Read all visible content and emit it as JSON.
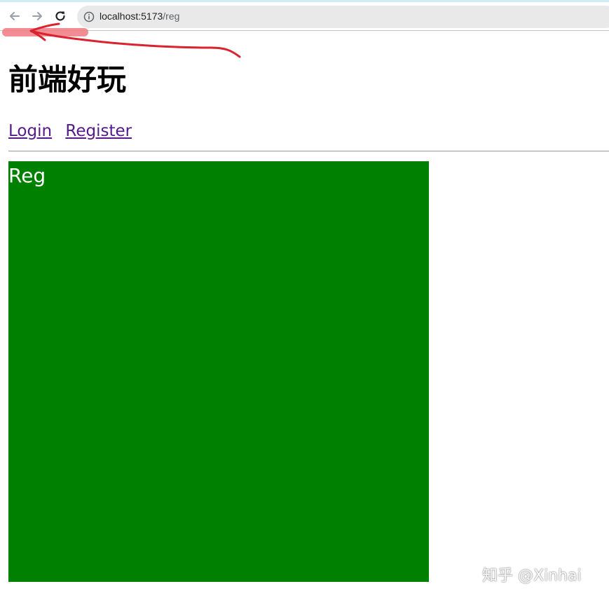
{
  "browser": {
    "url_host": "localhost:5173",
    "url_path": "/reg",
    "icons": {
      "back": "arrow-left-icon",
      "forward": "arrow-right-icon",
      "reload": "reload-icon",
      "info": "info-circle-icon"
    }
  },
  "page": {
    "title": "前端好玩",
    "nav": {
      "login": "Login",
      "register": "Register"
    },
    "content_box": {
      "label": "Reg",
      "background": "#008000",
      "text_color": "#ffffff"
    }
  },
  "watermark": "知乎 @Xinhai",
  "colors": {
    "link": "#551a8b",
    "annotation": "#d9232e"
  }
}
